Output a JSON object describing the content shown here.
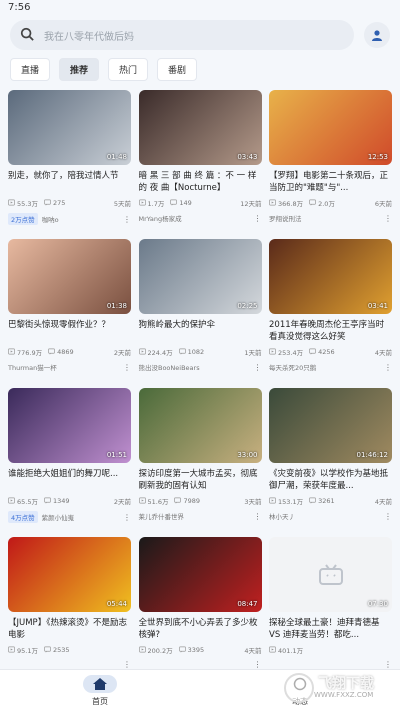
{
  "status": {
    "time": "7:56"
  },
  "search": {
    "placeholder": "我在八零年代做后妈"
  },
  "tabs": [
    "直播",
    "推荐",
    "热门",
    "番剧"
  ],
  "videos": [
    {
      "title": "别走，就你了，陪我过情人节",
      "views": "55.3万",
      "comments": "275",
      "time": "5天前",
      "badge": "2万点赞",
      "author": "咖呐o",
      "duration": "01:48",
      "colors": [
        "#5b6a7c",
        "#c9cfd6"
      ]
    },
    {
      "title": "暗 黑 三 部 曲 终 篇 ：不 一 样 的 夜 曲【Nocturne】",
      "views": "1.7万",
      "comments": "149",
      "time": "12天前",
      "badge": "",
      "author": "MrYang杨家成",
      "duration": "03:43",
      "colors": [
        "#3a2b2a",
        "#b49a8a"
      ]
    },
    {
      "title": "【罗翔】电影第二十条观后，正当防卫的\"难题\"与\"...",
      "views": "366.8万",
      "comments": "2.0万",
      "time": "6天前",
      "badge": "",
      "author": "罗翔说刑法",
      "duration": "12:53",
      "colors": [
        "#e8b24a",
        "#d04a2a"
      ]
    },
    {
      "title": "巴黎街头惊现零假作业？？",
      "views": "776.9万",
      "comments": "4869",
      "time": "2天前",
      "badge": "",
      "author": "Thurman猫一杯",
      "duration": "01:38",
      "colors": [
        "#e7b9a0",
        "#7a5040"
      ]
    },
    {
      "title": "狗熊岭最大的保护伞",
      "views": "224.4万",
      "comments": "1082",
      "time": "1天前",
      "badge": "",
      "author": "熊出没BooNeiBears",
      "duration": "02:25",
      "colors": [
        "#6b7a8a",
        "#d4d8dc"
      ]
    },
    {
      "title": "2011年春晚周杰伦王亭序当时看真没觉得这么好笑",
      "views": "253.4万",
      "comments": "4256",
      "time": "4天前",
      "badge": "",
      "author": "每天杀死20只鹅",
      "duration": "03:41",
      "colors": [
        "#5a2a1a",
        "#e0a030"
      ]
    },
    {
      "title": "谁能拒绝大姐姐们的舞刀呢...",
      "views": "65.5万",
      "comments": "1349",
      "time": "2天前",
      "badge": "4万点赞",
      "author": "紫颜小仙嵬",
      "duration": "01:51",
      "colors": [
        "#3a2a5a",
        "#c090d0"
      ]
    },
    {
      "title": "探访印度第一大城市孟买，彻底刷新我的固有认知",
      "views": "51.6万",
      "comments": "7989",
      "time": "3天前",
      "badge": "",
      "author": "莱儿乔什番世界",
      "duration": "33:00",
      "colors": [
        "#4a6a3a",
        "#c8b080"
      ]
    },
    {
      "title": "《灾变前夜》以学校作为基地抵御尸潮，荣获年度最...",
      "views": "153.1万",
      "comments": "3261",
      "time": "4天前",
      "badge": "",
      "author": "林小天丿",
      "duration": "01:46:12",
      "colors": [
        "#3a4a3a",
        "#a08a60"
      ]
    },
    {
      "title": "【JUMP】《热辣滚烫》不是励志电影",
      "views": "95.1万",
      "comments": "2535",
      "time": "",
      "badge": "",
      "author": "",
      "duration": "05:44",
      "colors": [
        "#c01818",
        "#f0c020"
      ]
    },
    {
      "title": "全世界到底不小心弄丢了多少枚核弹?",
      "views": "200.2万",
      "comments": "3395",
      "time": "4天前",
      "badge": "",
      "author": "",
      "duration": "08:47",
      "colors": [
        "#1a1a1a",
        "#c02020"
      ]
    },
    {
      "title": "探秘全球最土豪！迪拜青德基 VS 迪拜麦当劳！都吃...",
      "views": "401.1万",
      "comments": "",
      "time": "",
      "badge": "",
      "author": "",
      "duration": "07:30",
      "colors": [
        "#f2f3f5",
        "#f2f3f5"
      ]
    }
  ],
  "nav": [
    {
      "label": "首页",
      "icon": "home-icon"
    },
    {
      "label": "动态",
      "icon": "circle-icon"
    }
  ],
  "watermark": {
    "text": "飞翔下载",
    "sub": "WWW.FXXZ.COM"
  }
}
